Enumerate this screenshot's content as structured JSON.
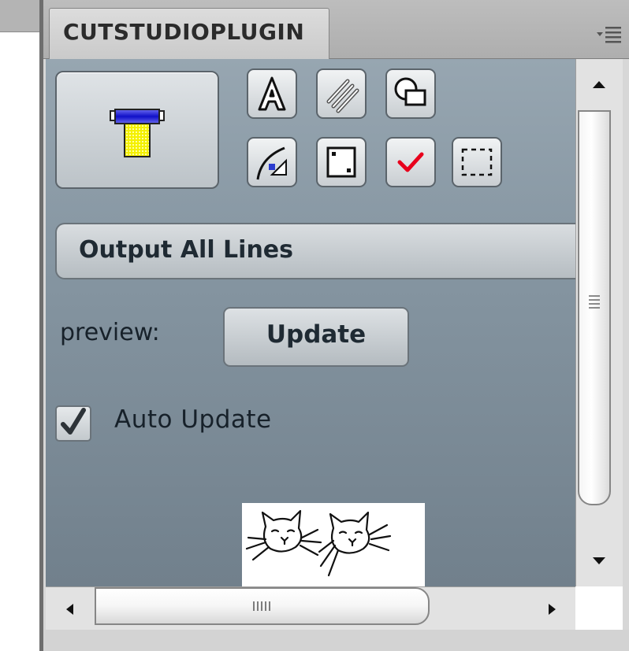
{
  "panel": {
    "tab_title": "CUTSTUDIOPLUGIN",
    "menu_icon": "panel-menu-icon"
  },
  "toolbar": {
    "main_button_icon": "cutter-icon",
    "icons": [
      "text-outline-icon",
      "hatch-icon",
      "shape-merge-icon",
      "curve-edit-icon",
      "registration-marks-icon",
      "checkmark-icon",
      "dashed-selection-icon"
    ]
  },
  "output": {
    "label": "Output All Lines"
  },
  "preview": {
    "label": "preview:",
    "update_button": "Update",
    "auto_update_label": "Auto Update",
    "auto_update_checked": true
  },
  "colors": {
    "content_background": "#8595a1",
    "check_red": "#e8001c"
  }
}
